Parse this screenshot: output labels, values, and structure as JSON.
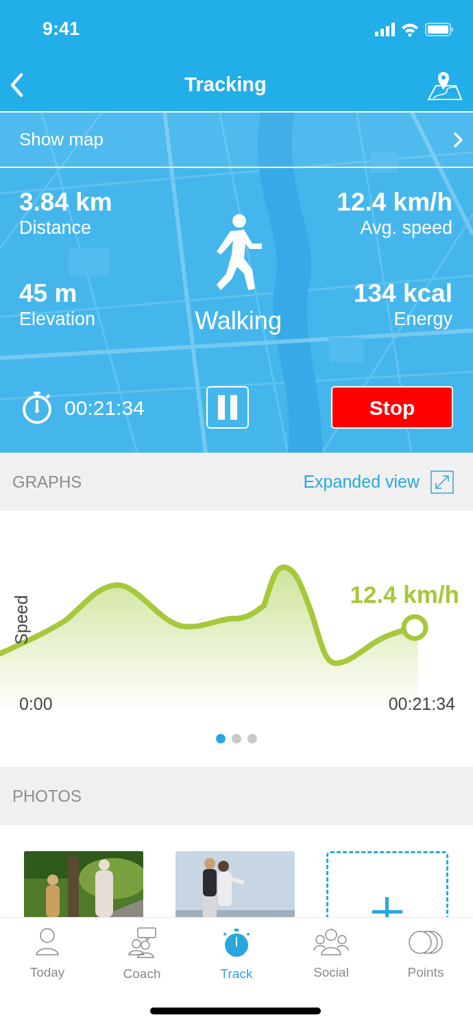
{
  "status_bar": {
    "time": "9:41"
  },
  "nav": {
    "title": "Tracking"
  },
  "map_link": {
    "label": "Show map"
  },
  "stats_left": [
    {
      "value": "3.84 km",
      "label": "Distance"
    },
    {
      "value": "45 m",
      "label": "Elevation"
    }
  ],
  "stats_right": [
    {
      "value": "12.4 km/h",
      "label": "Avg. speed"
    },
    {
      "value": "134 kcal",
      "label": "Energy"
    }
  ],
  "activity": {
    "label": "Walking"
  },
  "timer": {
    "elapsed": "00:21:34"
  },
  "controls": {
    "stop": "Stop"
  },
  "graphs": {
    "title": "GRAPHS",
    "link": "Expanded view",
    "y_label": "Speed",
    "current_value": "12.4 km/h",
    "start_label": "0:00",
    "end_label": "00:21:34",
    "pages": [
      {
        "selected": true
      },
      {
        "selected": false
      },
      {
        "selected": false
      }
    ]
  },
  "photos": {
    "title": "PHOTOS",
    "items": [
      {
        "kind": "picture"
      },
      {
        "kind": "picture"
      },
      {
        "kind": "add"
      }
    ]
  },
  "tab_bar": [
    {
      "label": "Today",
      "kind": "person",
      "selected": false
    },
    {
      "label": "Coach",
      "kind": "coach",
      "selected": false
    },
    {
      "label": "Track",
      "kind": "stopwatch",
      "selected": true
    },
    {
      "label": "Social",
      "kind": "group",
      "selected": false
    },
    {
      "label": "Points",
      "kind": "coins",
      "selected": false
    }
  ]
}
